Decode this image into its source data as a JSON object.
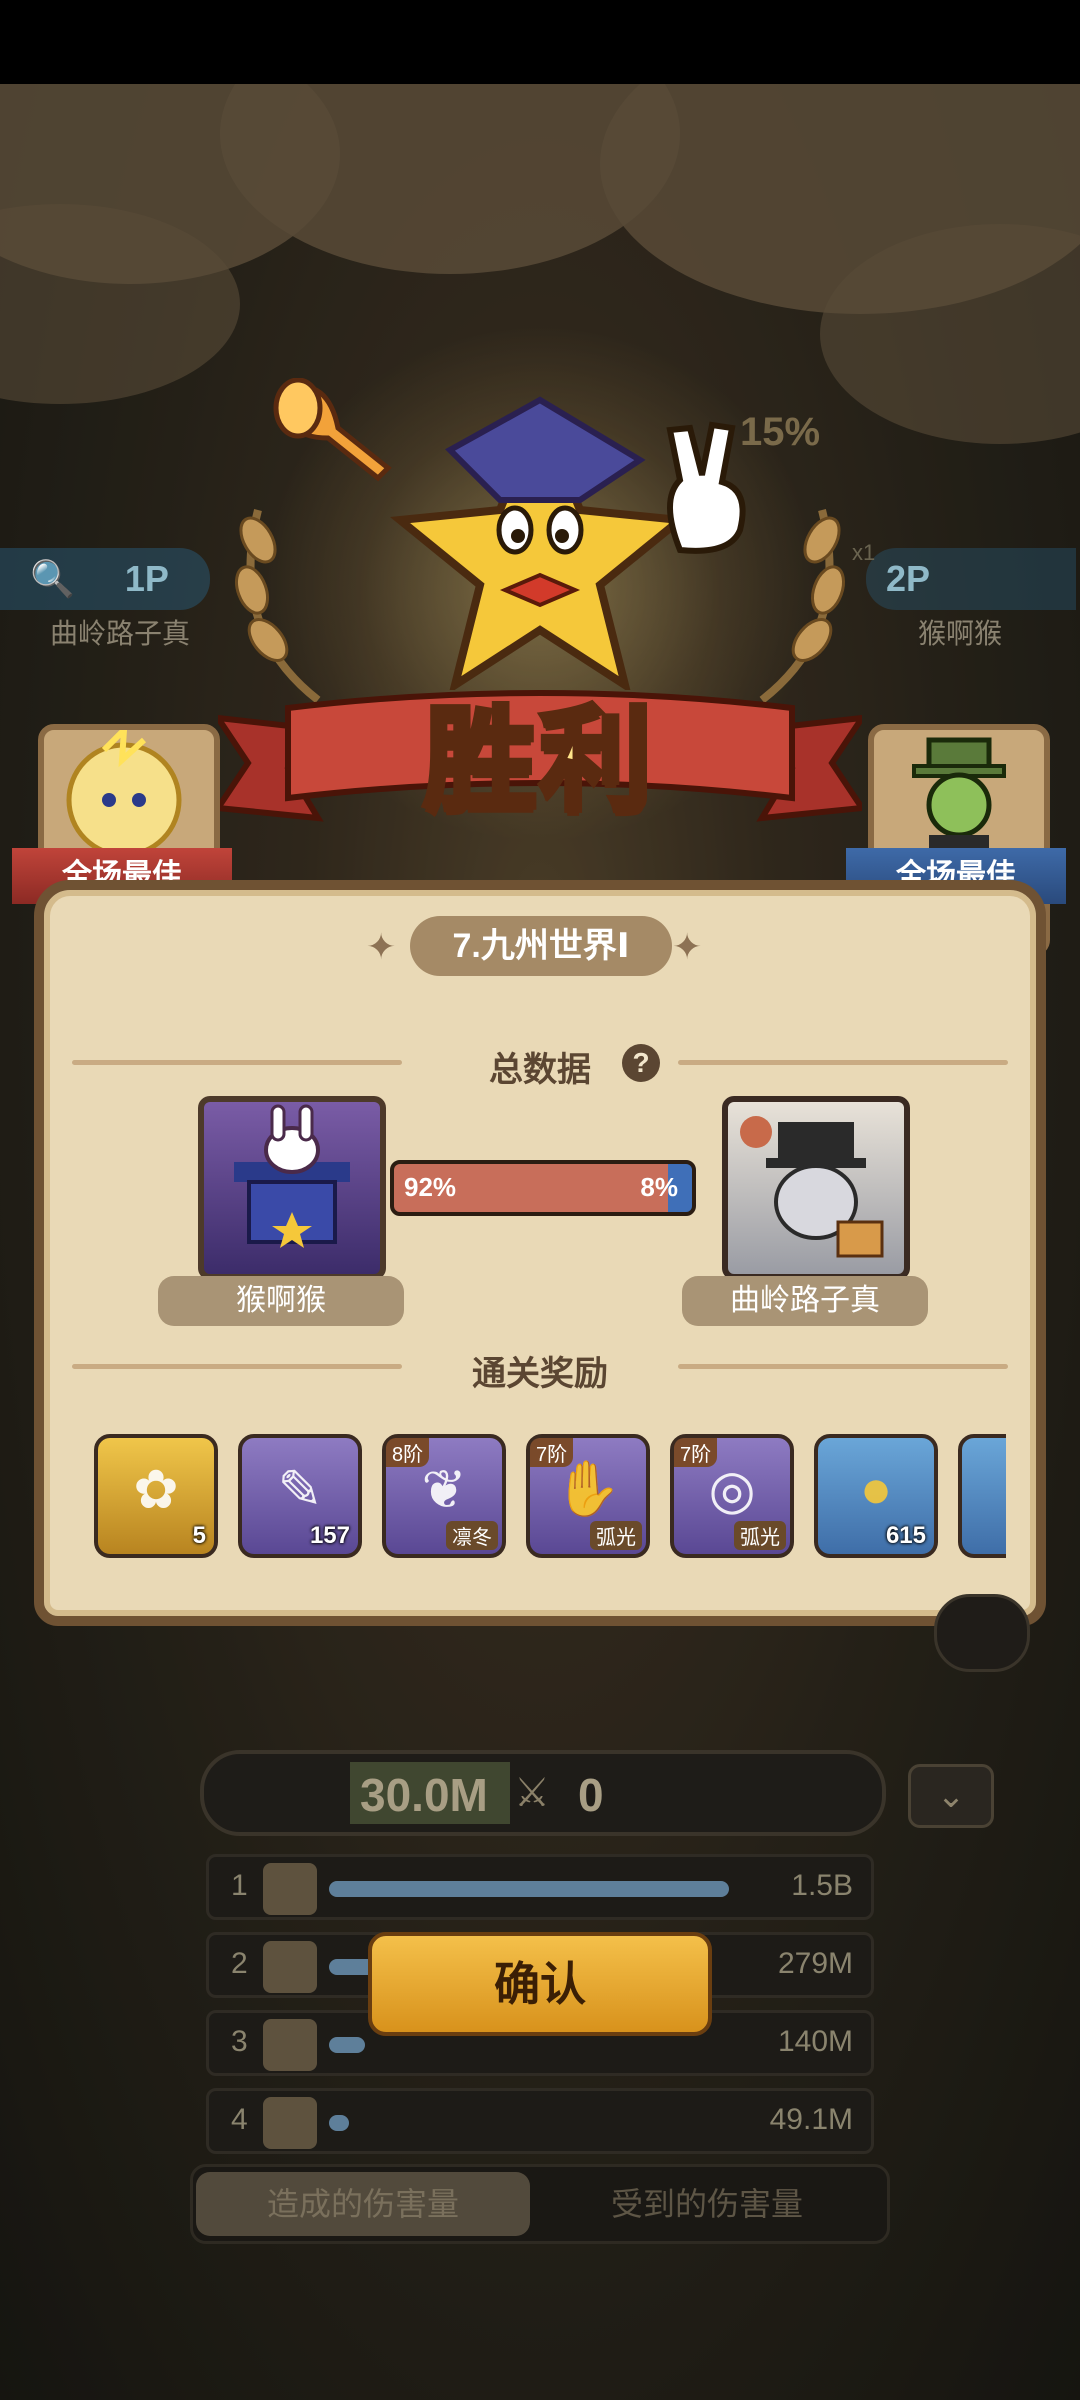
{
  "victory_title": "胜利",
  "players": {
    "left": {
      "slot": "1P",
      "name": "曲岭路子真"
    },
    "right": {
      "slot": "2P",
      "name": "猴啊猴"
    }
  },
  "hud_percent": "15%",
  "hud_multiplier": "x1",
  "best_player_label_left": "全场最佳",
  "best_player_label_right": "全场最佳",
  "panel": {
    "level_name": "7.九州世界Ⅰ",
    "total_data_title": "总数据",
    "help_symbol": "?",
    "left_player_name": "猴啊猴",
    "right_player_name": "曲岭路子真",
    "left_ratio_text": "92%",
    "right_ratio_text": "8%",
    "left_ratio": 0.92,
    "right_ratio": 0.08,
    "rewards_title": "通关奖励",
    "rewards": [
      {
        "icon": "gear-ornament-icon",
        "count": "5",
        "tier": "",
        "tag": ""
      },
      {
        "icon": "scroll-quill-icon",
        "count": "157",
        "tier": "",
        "tag": ""
      },
      {
        "icon": "winged-boot-icon",
        "count": "",
        "tier": "8阶",
        "tag": "凛冬"
      },
      {
        "icon": "winged-glove-icon",
        "count": "",
        "tier": "7阶",
        "tag": "弧光"
      },
      {
        "icon": "winged-halo-icon",
        "count": "",
        "tier": "7阶",
        "tag": "弧光"
      },
      {
        "icon": "gold-coin-icon",
        "count": "615",
        "tier": "",
        "tag": ""
      }
    ]
  },
  "stats": {
    "total_damage": "30.0M",
    "opponent_damage": "0",
    "rows": [
      {
        "rank": "1",
        "value": "1.5B",
        "fill": 1.0
      },
      {
        "rank": "2",
        "value": "279M",
        "fill": 0.19
      },
      {
        "rank": "3",
        "value": "140M",
        "fill": 0.09
      },
      {
        "rank": "4",
        "value": "49.1M",
        "fill": 0.03
      }
    ],
    "tab_dealt": "造成的伤害量",
    "tab_taken": "受到的伤害量"
  },
  "confirm_label": "确认",
  "colors": {
    "accent_gold": "#f4c04a",
    "best_red": "#c0443a",
    "best_blue": "#3e6aa8"
  }
}
